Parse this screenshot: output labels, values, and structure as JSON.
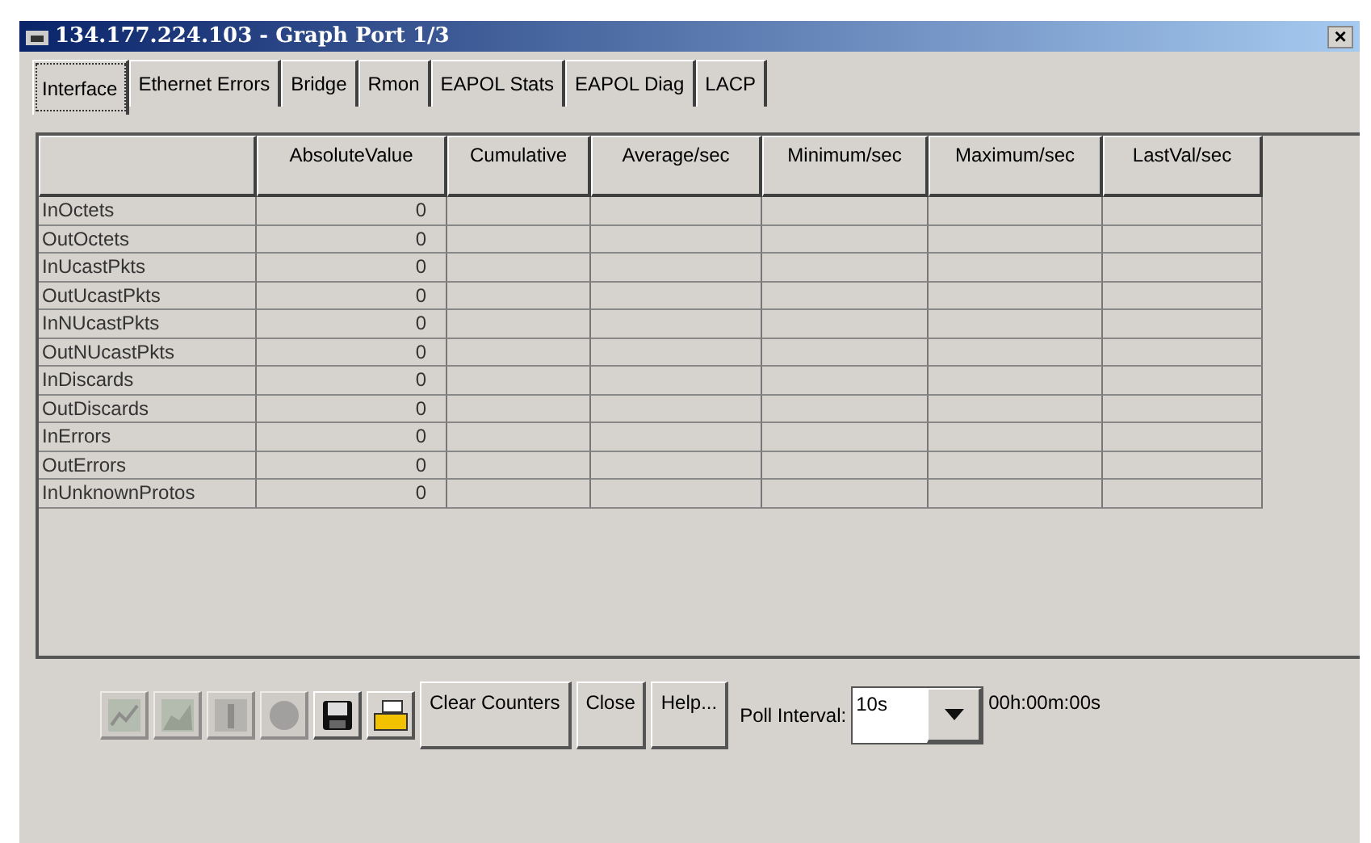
{
  "window": {
    "title": "134.177.224.103 - Graph Port 1/3",
    "close": "×"
  },
  "tabs": [
    {
      "label": "Interface",
      "selected": true
    },
    {
      "label": "Ethernet Errors",
      "selected": false
    },
    {
      "label": "Bridge",
      "selected": false
    },
    {
      "label": "Rmon",
      "selected": false
    },
    {
      "label": "EAPOL Stats",
      "selected": false
    },
    {
      "label": "EAPOL Diag",
      "selected": false
    },
    {
      "label": "LACP",
      "selected": false
    }
  ],
  "table": {
    "columns": [
      "AbsoluteValue",
      "Cumulative",
      "Average/sec",
      "Minimum/sec",
      "Maximum/sec",
      "LastVal/sec"
    ],
    "rows": [
      {
        "name": "InOctets",
        "values": [
          "0"
        ]
      },
      {
        "name": "OutOctets",
        "values": [
          "0"
        ]
      },
      {
        "name": "InUcastPkts",
        "values": [
          "0"
        ]
      },
      {
        "name": "OutUcastPkts",
        "values": [
          "0"
        ]
      },
      {
        "name": "InNUcastPkts",
        "values": [
          "0"
        ]
      },
      {
        "name": "OutNUcastPkts",
        "values": [
          "0"
        ]
      },
      {
        "name": "InDiscards",
        "values": [
          "0"
        ]
      },
      {
        "name": "OutDiscards",
        "values": [
          "0"
        ]
      },
      {
        "name": "InErrors",
        "values": [
          "0"
        ]
      },
      {
        "name": "OutErrors",
        "values": [
          "0"
        ]
      },
      {
        "name": "InUnknownProtos",
        "values": [
          "0"
        ]
      }
    ]
  },
  "toolbar": {
    "icons": [
      {
        "kind": "line",
        "disabled": true
      },
      {
        "kind": "area",
        "disabled": true
      },
      {
        "kind": "bar",
        "disabled": true
      },
      {
        "kind": "pie",
        "disabled": true
      },
      {
        "kind": "save",
        "disabled": false
      },
      {
        "kind": "print",
        "disabled": false
      }
    ],
    "buttons": [
      "Clear Counters",
      "Close",
      "Help..."
    ],
    "poll_label": "Poll Interval:",
    "poll_value": "10s",
    "elapsed": "00h:00m:00s"
  }
}
